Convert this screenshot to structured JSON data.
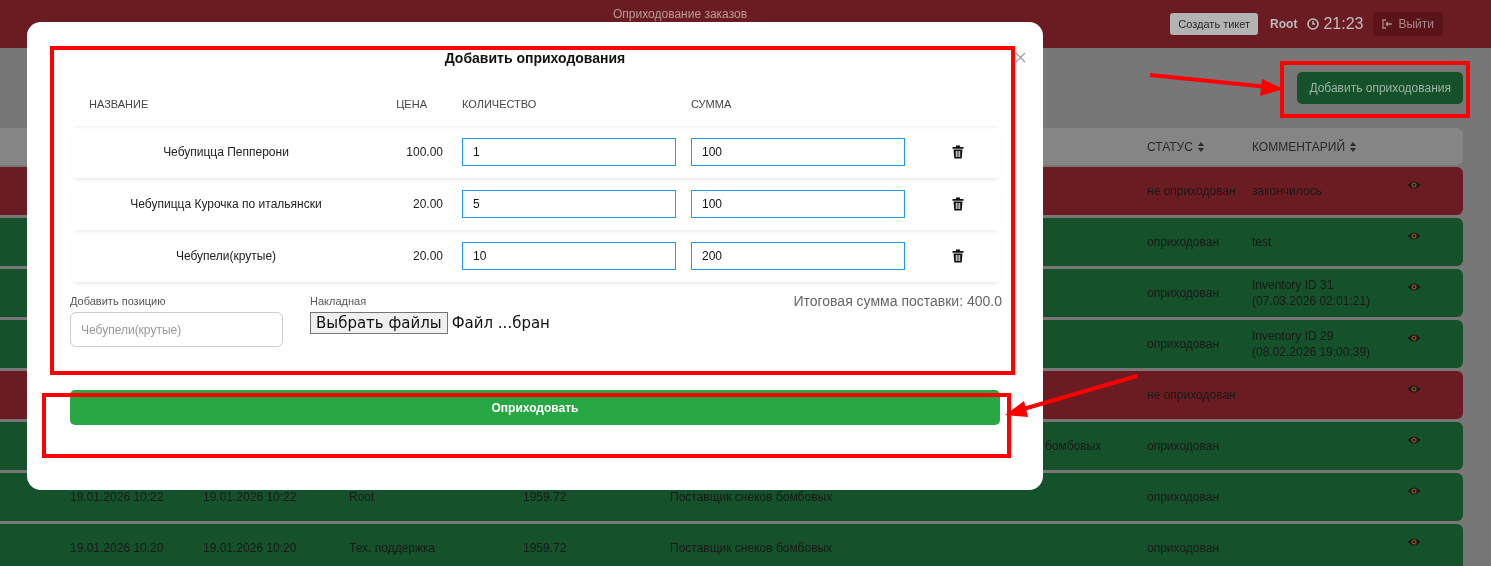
{
  "header": {
    "title": "Оприходование заказов",
    "create_ticket_button": "Создать тикет",
    "user": "Root",
    "time": "21:23",
    "logout_button": "Выйти"
  },
  "add_button": "Добавить оприходования",
  "table": {
    "columns": [
      {
        "label": "СТАТУС"
      },
      {
        "label": "КОММЕНТАРИЙ"
      }
    ],
    "rows": [
      {
        "color": "#6b1c22",
        "status": "не оприходован",
        "comment": "закончилось"
      },
      {
        "color": "#15512a",
        "status": "оприходован",
        "comment": "test"
      },
      {
        "color": "#15512a",
        "status": "оприходован",
        "comment": "Inventory ID 31\n(07.03.2026 02:01:21)"
      },
      {
        "color": "#15512a",
        "status": "оприходован",
        "comment": "Inventory ID 29\n(08.02.2026 19:00:39)"
      },
      {
        "color": "#6b1c22",
        "status": "не оприходован"
      },
      {
        "color": "#15512a",
        "supplier_tail": "бомбовых",
        "status": "оприходован"
      },
      {
        "color": "#15512a",
        "created": "19.01.2026 10:22",
        "updated": "19.01.2026 10:22",
        "user": "Root",
        "sum": "1959.72",
        "supplier": "Поставщик снеков бомбовых",
        "status": "оприходован"
      },
      {
        "color": "#15512a",
        "created": "19.01.2026 10:20",
        "updated": "19.01.2026 10:20",
        "user": "Тех. поддержка",
        "sum": "1959.72",
        "supplier": "Поставщик снеков бомбовых",
        "status": "оприходован"
      }
    ]
  },
  "dialog": {
    "title": "Добавить оприходования",
    "columns": [
      "НАЗВАНИЕ",
      "ЦЕНА",
      "КОЛИЧЕСТВО",
      "СУММА"
    ],
    "items": [
      {
        "name": "Чебупицца Пепперони",
        "price": "100.00",
        "quantity": "1",
        "sum": "100"
      },
      {
        "name": "Чебупицца Курочка по итальянски",
        "price": "20.00",
        "quantity": "5",
        "sum": "100"
      },
      {
        "name": "Чебупели(крутые)",
        "price": "20.00",
        "quantity": "10",
        "sum": "200"
      }
    ],
    "add_item": {
      "label": "Добавить позицию",
      "placeholder": "Чебупели(крутые)"
    },
    "invoice": {
      "label": "Накладная",
      "button": "Выбрать файлы",
      "file_status": "Файл ...бран"
    },
    "total": "Итоговая сумма поставки: 400.0",
    "submit_button": "Оприходовать"
  }
}
